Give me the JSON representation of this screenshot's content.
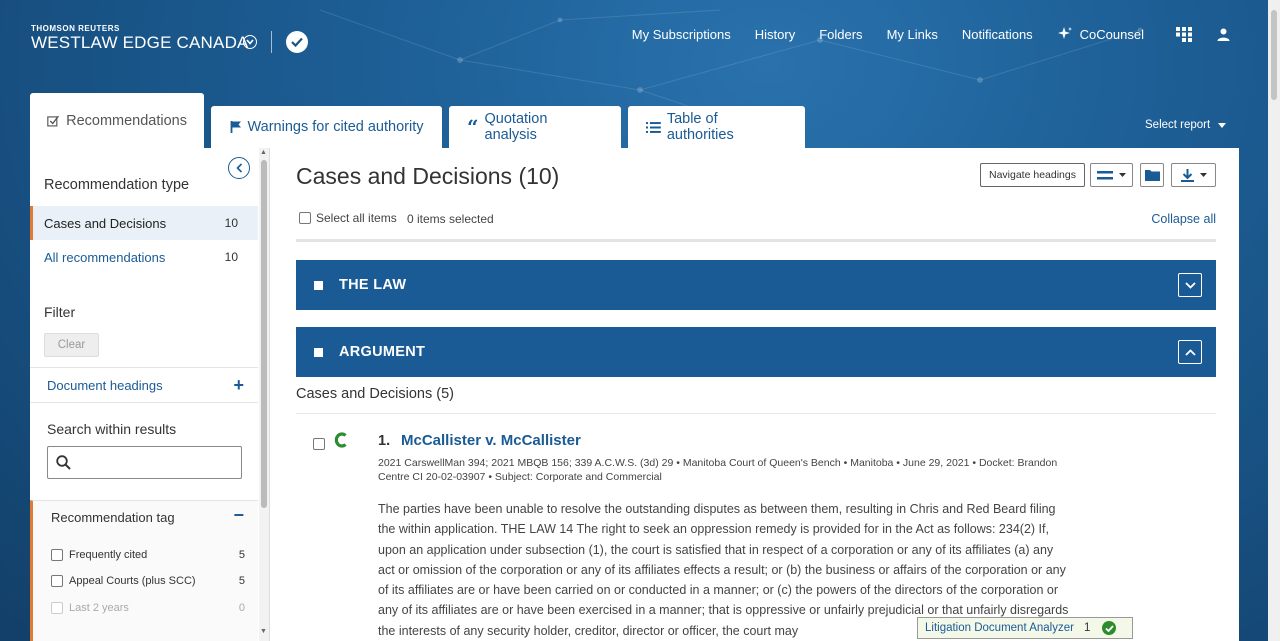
{
  "brand": {
    "company": "THOMSON REUTERS",
    "product": "WESTLAW EDGE CANADA"
  },
  "topnav": {
    "items": [
      "My Subscriptions",
      "History",
      "Folders",
      "My Links",
      "Notifications",
      "CoCounsel"
    ]
  },
  "tabs": [
    {
      "label": "Recommendations",
      "icon": "checkbox-icon"
    },
    {
      "label": "Warnings for cited authority",
      "icon": "flag-icon"
    },
    {
      "label": "Quotation analysis",
      "icon": "quote-icon"
    },
    {
      "label": "Table of authorities",
      "icon": "list-icon"
    }
  ],
  "select_report": "Select report",
  "sidebar": {
    "rec_type_title": "Recommendation type",
    "types": [
      {
        "label": "Cases and Decisions",
        "count": "10"
      },
      {
        "label": "All recommendations",
        "count": "10"
      }
    ],
    "filter_title": "Filter",
    "clear": "Clear",
    "doc_headings": "Document headings",
    "search_title": "Search within results",
    "search_placeholder": "",
    "rec_tag_title": "Recommendation tag",
    "tags": [
      {
        "label": "Frequently cited",
        "count": "5"
      },
      {
        "label": "Appeal Courts (plus SCC)",
        "count": "5"
      },
      {
        "label": "Last 2 years",
        "count": "0"
      }
    ]
  },
  "content": {
    "title": "Cases and Decisions (10)",
    "navigate_headings": "Navigate headings",
    "select_all": "Select all items",
    "selected": "0 items selected",
    "collapse_all": "Collapse all",
    "sections": [
      {
        "label": "THE LAW",
        "state": "collapsed"
      },
      {
        "label": "ARGUMENT",
        "state": "expanded"
      }
    ],
    "sub_heading": "Cases and Decisions (5)",
    "result": {
      "number": "1.",
      "title": "McCallister v. McCallister",
      "meta": "2021 CarswellMan 394; 2021 MBQB 156; 339 A.C.W.S. (3d) 29  •  Manitoba Court of Queen's Bench  •  Manitoba  •  June 29, 2021  •  Docket: Brandon Centre CI 20-02-03907  •  Subject: Corporate and Commercial",
      "body": "The parties have been unable to resolve the outstanding disputes as between them, resulting in Chris and Red Beard filing the within application. THE LAW 14 The right to seek an oppression remedy is provided for in the Act as follows: 234(2) If, upon an application under subsection (1), the court is satisfied that in respect of a corporation or any of its affiliates (a) any act or omission of the corporation or any of its affiliates effects a result; or (b) the business or affairs of the corporation or any of its affiliates are or have been carried on or conducted in a manner; or (c) the powers of the directors of the corporation or any of its affiliates are or have been exercised in a manner; that is oppressive or unfairly prejudicial or that unfairly disregards the interests of any security holder, creditor, director or officer, the court may"
    }
  },
  "lda": {
    "label": "Litigation Document Analyzer",
    "count": "1"
  }
}
